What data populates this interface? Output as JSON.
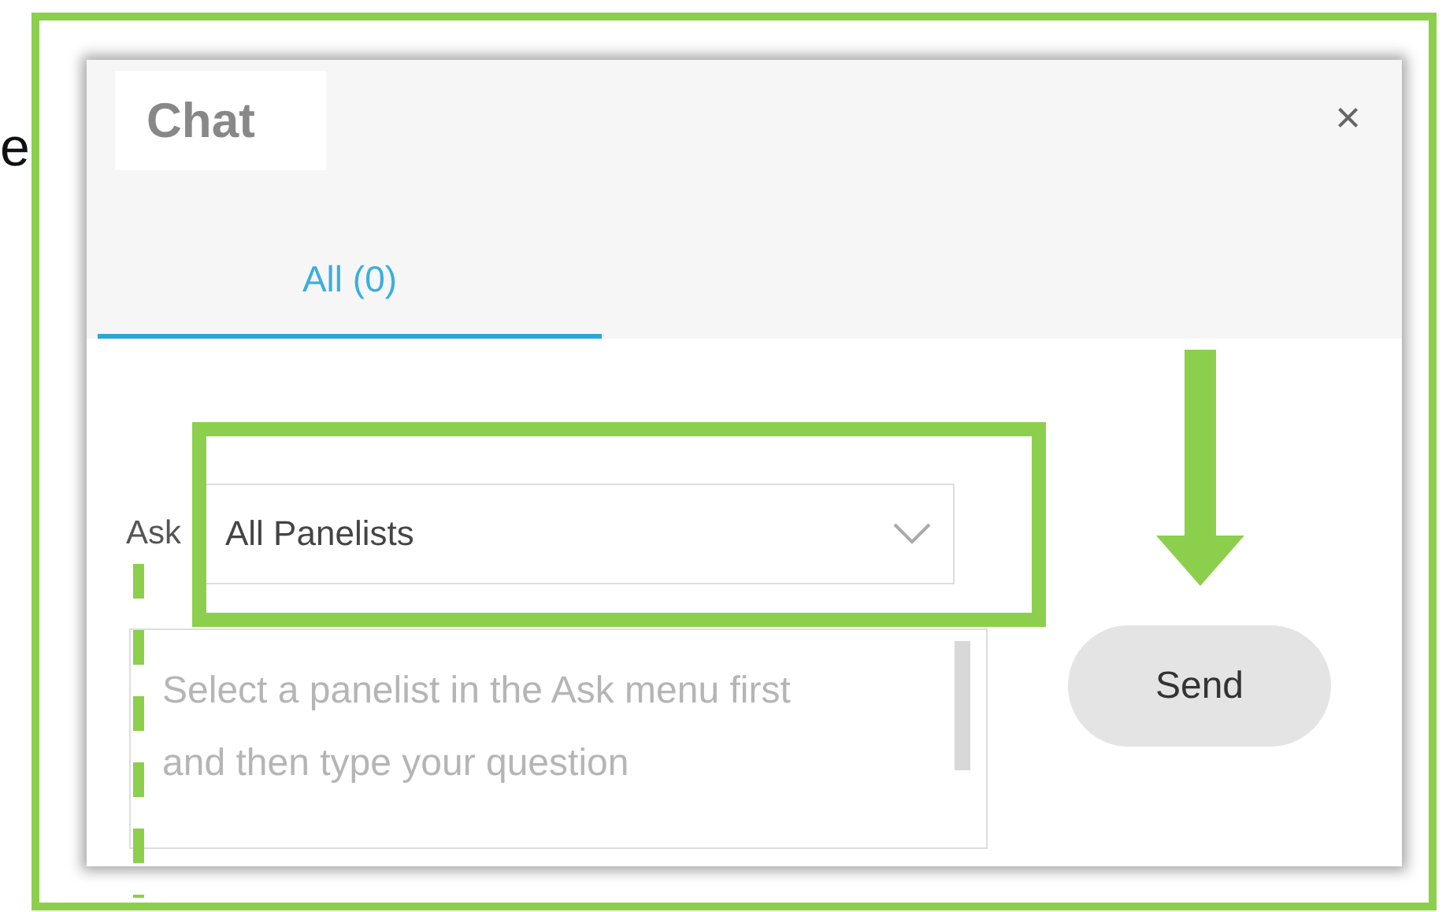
{
  "left_edge_text": "e",
  "chat": {
    "title": "Chat",
    "close": "×",
    "tabs": [
      {
        "label": "All (0)",
        "selected": true
      }
    ],
    "ask_label": "Ask",
    "ask_dropdown": {
      "value": "All Panelists"
    },
    "message": {
      "placeholder": "Select a panelist in the Ask menu first and then type your question"
    },
    "send_button": "Send"
  }
}
